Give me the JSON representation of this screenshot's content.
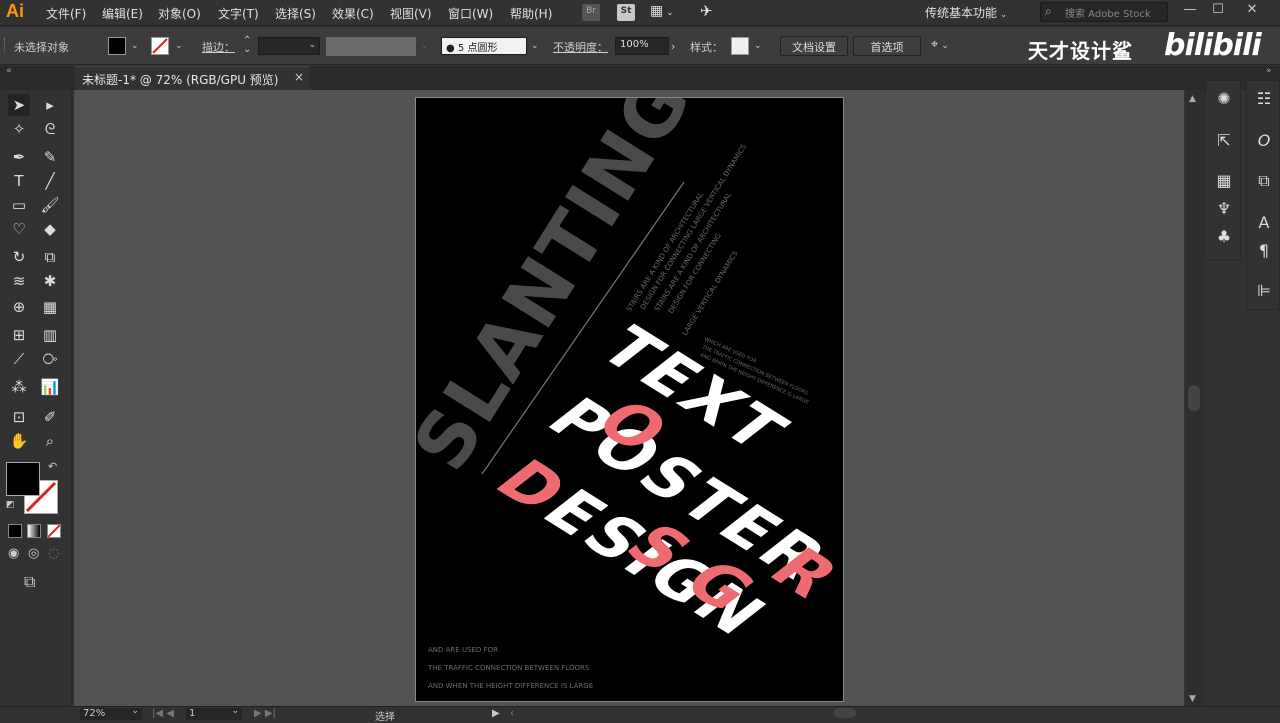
{
  "app": {
    "logo": "Ai"
  },
  "menubar": {
    "items": [
      "文件(F)",
      "编辑(E)",
      "对象(O)",
      "文字(T)",
      "选择(S)",
      "效果(C)",
      "视图(V)",
      "窗口(W)",
      "帮助(H)"
    ],
    "bridge_label": "Br",
    "stock_label": "St",
    "workspace": "传统基本功能",
    "search_placeholder": "搜索 Adobe Stock"
  },
  "control": {
    "no_selection": "未选择对象",
    "stroke_label": "描边：",
    "brush_label": "5 点圆形",
    "opacity_label": "不透明度：",
    "opacity_value": "100%",
    "style_label": "样式：",
    "doc_setup": "文档设置",
    "preferences": "首选项"
  },
  "watermark": {
    "text": "天才设计鲨",
    "bili": "bilibili"
  },
  "tab": {
    "label": "未标题-1* @ 72% (RGB/GPU 预览)",
    "close": "×"
  },
  "artwork": {
    "slanting": "SLANTING",
    "line1": "TEXT",
    "line2": "POSTER",
    "line3": "DESIGN",
    "small_block1": [
      "STAIRS ARE A KIND OF ARCHITECTURAL",
      "DESIGN FOR CONNECTING LARGE VERTICAL DYNAMICS",
      "STAIRS ARE A KIND OF ARCHITECTURAL",
      "DESIGN FOR CONNECTING",
      "LARGE VERTICAL DYNAMICS"
    ],
    "small_block2": [
      "WHICH ARE USED FOR",
      "THE TRAFFIC CONNECTION BETWEEN FLOORS",
      "AND WHEN THE HEIGHT DIFFERENCE IS LARGE"
    ],
    "footer": [
      "AND ARE USED FOR",
      "THE TRAFFIC CONNECTION BETWEEN FLOORS",
      "AND WHEN THE HEIGHT DIFFERENCE IS LARGE"
    ],
    "colors": {
      "white": "#ffffff",
      "pink": "#f06a72",
      "gray": "#4a4a4a",
      "bg": "#000000"
    }
  },
  "status": {
    "zoom": "72%",
    "page": "1",
    "mode": "选择"
  }
}
